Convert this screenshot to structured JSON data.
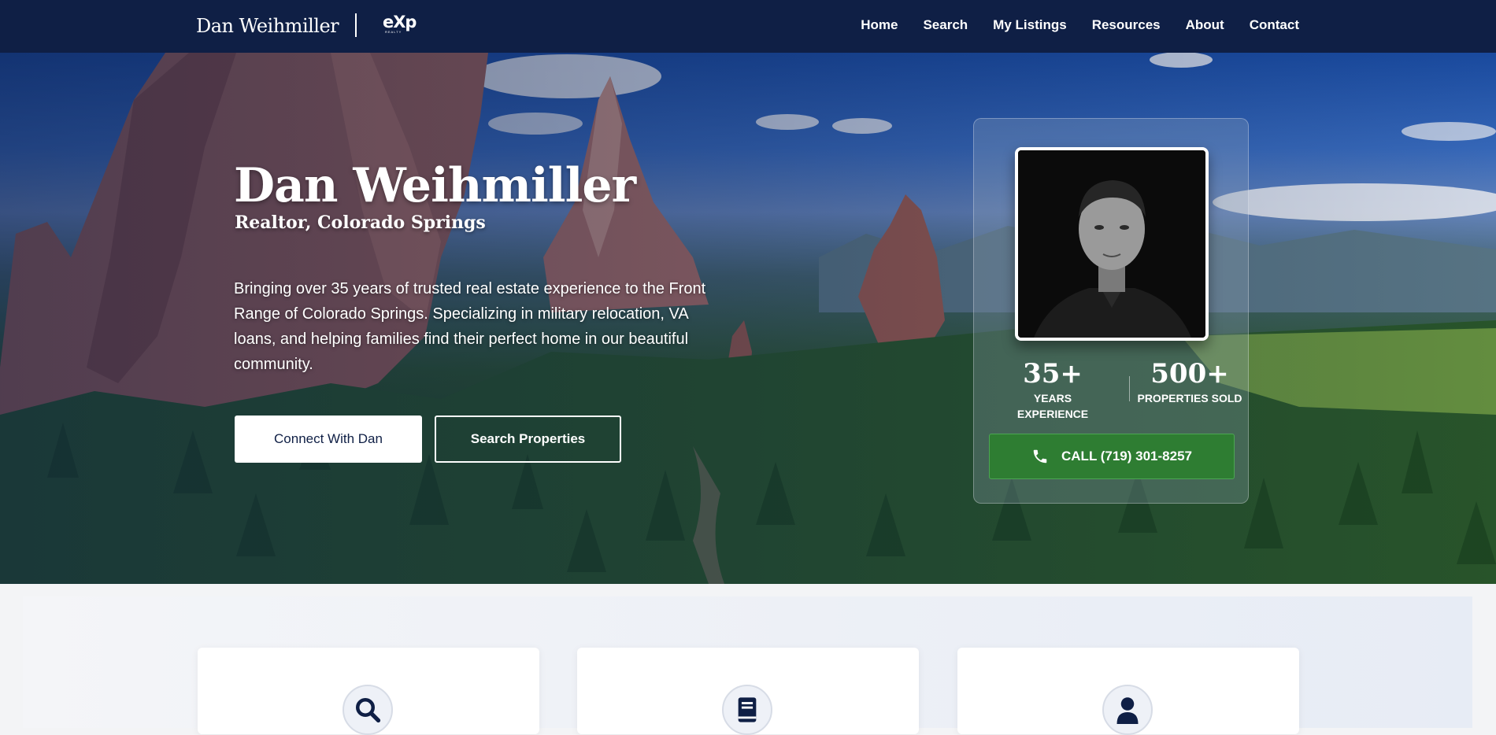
{
  "nav": {
    "brand": "Dan Weihmiller",
    "logo_text": "eXp",
    "logo_sub": "REALTY",
    "links": [
      "Home",
      "Search",
      "My Listings",
      "Resources",
      "About",
      "Contact"
    ]
  },
  "hero": {
    "name": "Dan Weihmiller",
    "subtitle": "Realtor, Colorado Springs",
    "description": "Bringing over 35 years of trusted real estate experience to the Front Range of Colorado Springs. Specializing in military relocation, VA loans, and helping families find their perfect home in our beautiful community.",
    "primary_button": "Connect With Dan",
    "secondary_button": "Search Properties"
  },
  "agent_card": {
    "stats": [
      {
        "number": "35+",
        "label": "YEARS EXPERIENCE"
      },
      {
        "number": "500+",
        "label": "PROPERTIES SOLD"
      }
    ],
    "call_button": "CALL (719) 301-8257"
  },
  "features": {
    "icons": [
      "search-icon",
      "book-icon",
      "user-icon"
    ]
  },
  "colors": {
    "nav_bg": "#0f1f45",
    "accent_green": "#2e7d32",
    "navy": "#0f1f45"
  }
}
